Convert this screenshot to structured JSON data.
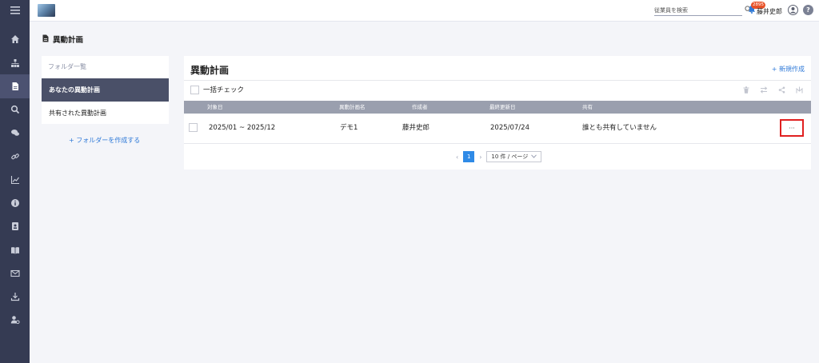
{
  "topbar": {
    "search_placeholder": "従業員を検索",
    "notification_count": "2895",
    "user_name": "藤井史郎",
    "help_symbol": "?"
  },
  "sidebar": {
    "icons": [
      "home-icon",
      "org-chart-icon",
      "document-icon",
      "search-icon",
      "chat-icon",
      "link-icon",
      "chart-icon",
      "info-icon",
      "id-card-icon",
      "book-icon",
      "mail-icon",
      "download-icon",
      "user-settings-icon"
    ],
    "active_index": 2
  },
  "page": {
    "title": "異動計画"
  },
  "folders": {
    "header": "フォルダ一覧",
    "items": [
      {
        "label": "あなたの異動計画",
        "active": true
      },
      {
        "label": "共有された異動計画",
        "active": false
      }
    ],
    "create_label": "+ フォルダーを作成する"
  },
  "main": {
    "title": "異動計画",
    "new_label": "+ 新規作成",
    "bulk_check_label": "一括チェック",
    "columns": [
      "対象日",
      "異動計画名",
      "作成者",
      "最終更新日",
      "共有"
    ],
    "rows": [
      {
        "period": "2025/01 ~ 2025/12",
        "name": "デモ1",
        "creator": "藤井史郎",
        "updated": "2025/07/24",
        "shared": "誰とも共有していません"
      }
    ],
    "more_label": "···",
    "pagination": {
      "current_page": "1",
      "page_size": "10 件 / ページ"
    }
  },
  "colors": {
    "rail": "#353b53",
    "accent": "#2f7ad8",
    "highlight_border": "#e02020"
  }
}
